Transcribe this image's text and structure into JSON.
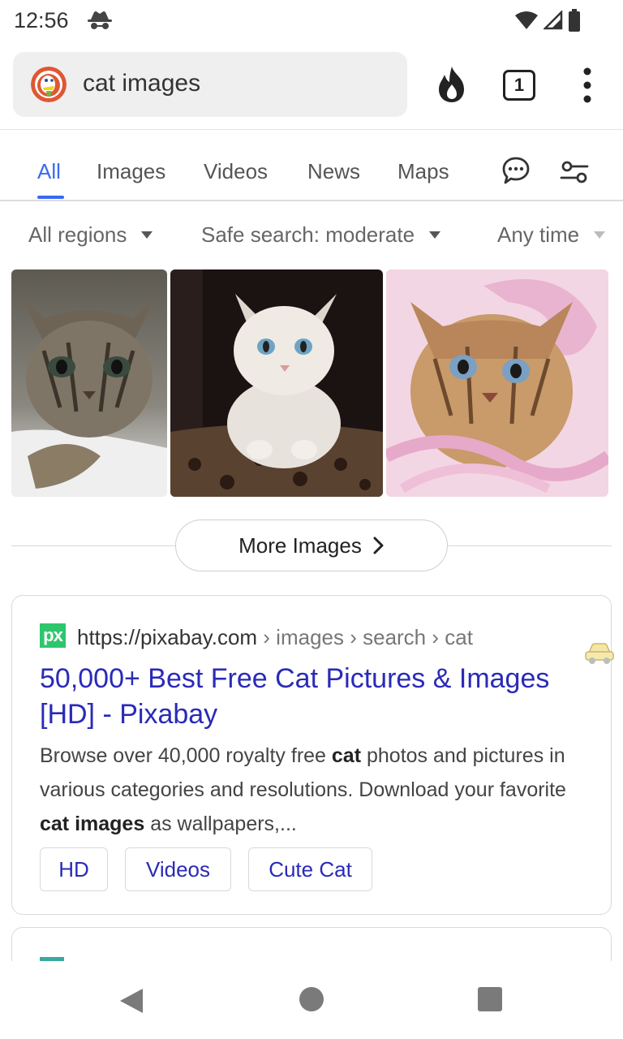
{
  "status_bar": {
    "time": "12:56",
    "icons": [
      "incognito-spy-icon",
      "wifi-icon",
      "cell-signal-icon",
      "battery-icon"
    ]
  },
  "address_bar": {
    "query": "cat images",
    "tab_count": "1",
    "icons": [
      "duckduckgo-logo",
      "fire-icon",
      "tabs-icon",
      "overflow-menu-icon"
    ]
  },
  "search_tabs": {
    "items": [
      {
        "label": "All",
        "active": true
      },
      {
        "label": "Images",
        "active": false
      },
      {
        "label": "Videos",
        "active": false
      },
      {
        "label": "News",
        "active": false
      },
      {
        "label": "Maps",
        "active": false
      }
    ],
    "icons": [
      "chat-icon",
      "settings-sliders-icon"
    ]
  },
  "filters": {
    "region": "All regions",
    "safe_search": "Safe search: moderate",
    "time": "Any time"
  },
  "images": {
    "tiles": [
      {
        "alt": "tabby kitten"
      },
      {
        "alt": "white kitten"
      },
      {
        "alt": "kitten with pink ribbon"
      }
    ],
    "more_label": "More Images"
  },
  "result": {
    "favicon_text": "px",
    "url_domain": "https://pixabay.com",
    "url_path": " › images › search › cat",
    "title": "50,000+ Best Free Cat Pictures & Images [HD] - Pixabay",
    "snippet_1": "Browse over 40,000 royalty free ",
    "snippet_bold_1": "cat",
    "snippet_2": " photos and pictures in various categories and resolutions. Download your favorite ",
    "snippet_bold_2": "cat images",
    "snippet_3": " as wallpapers,...",
    "sitelinks": [
      "HD",
      "Videos",
      "Cute Cat"
    ]
  },
  "colors": {
    "accent": "#3969ef",
    "link": "#2a2ab8",
    "pixabay_green": "#2ec66d"
  }
}
